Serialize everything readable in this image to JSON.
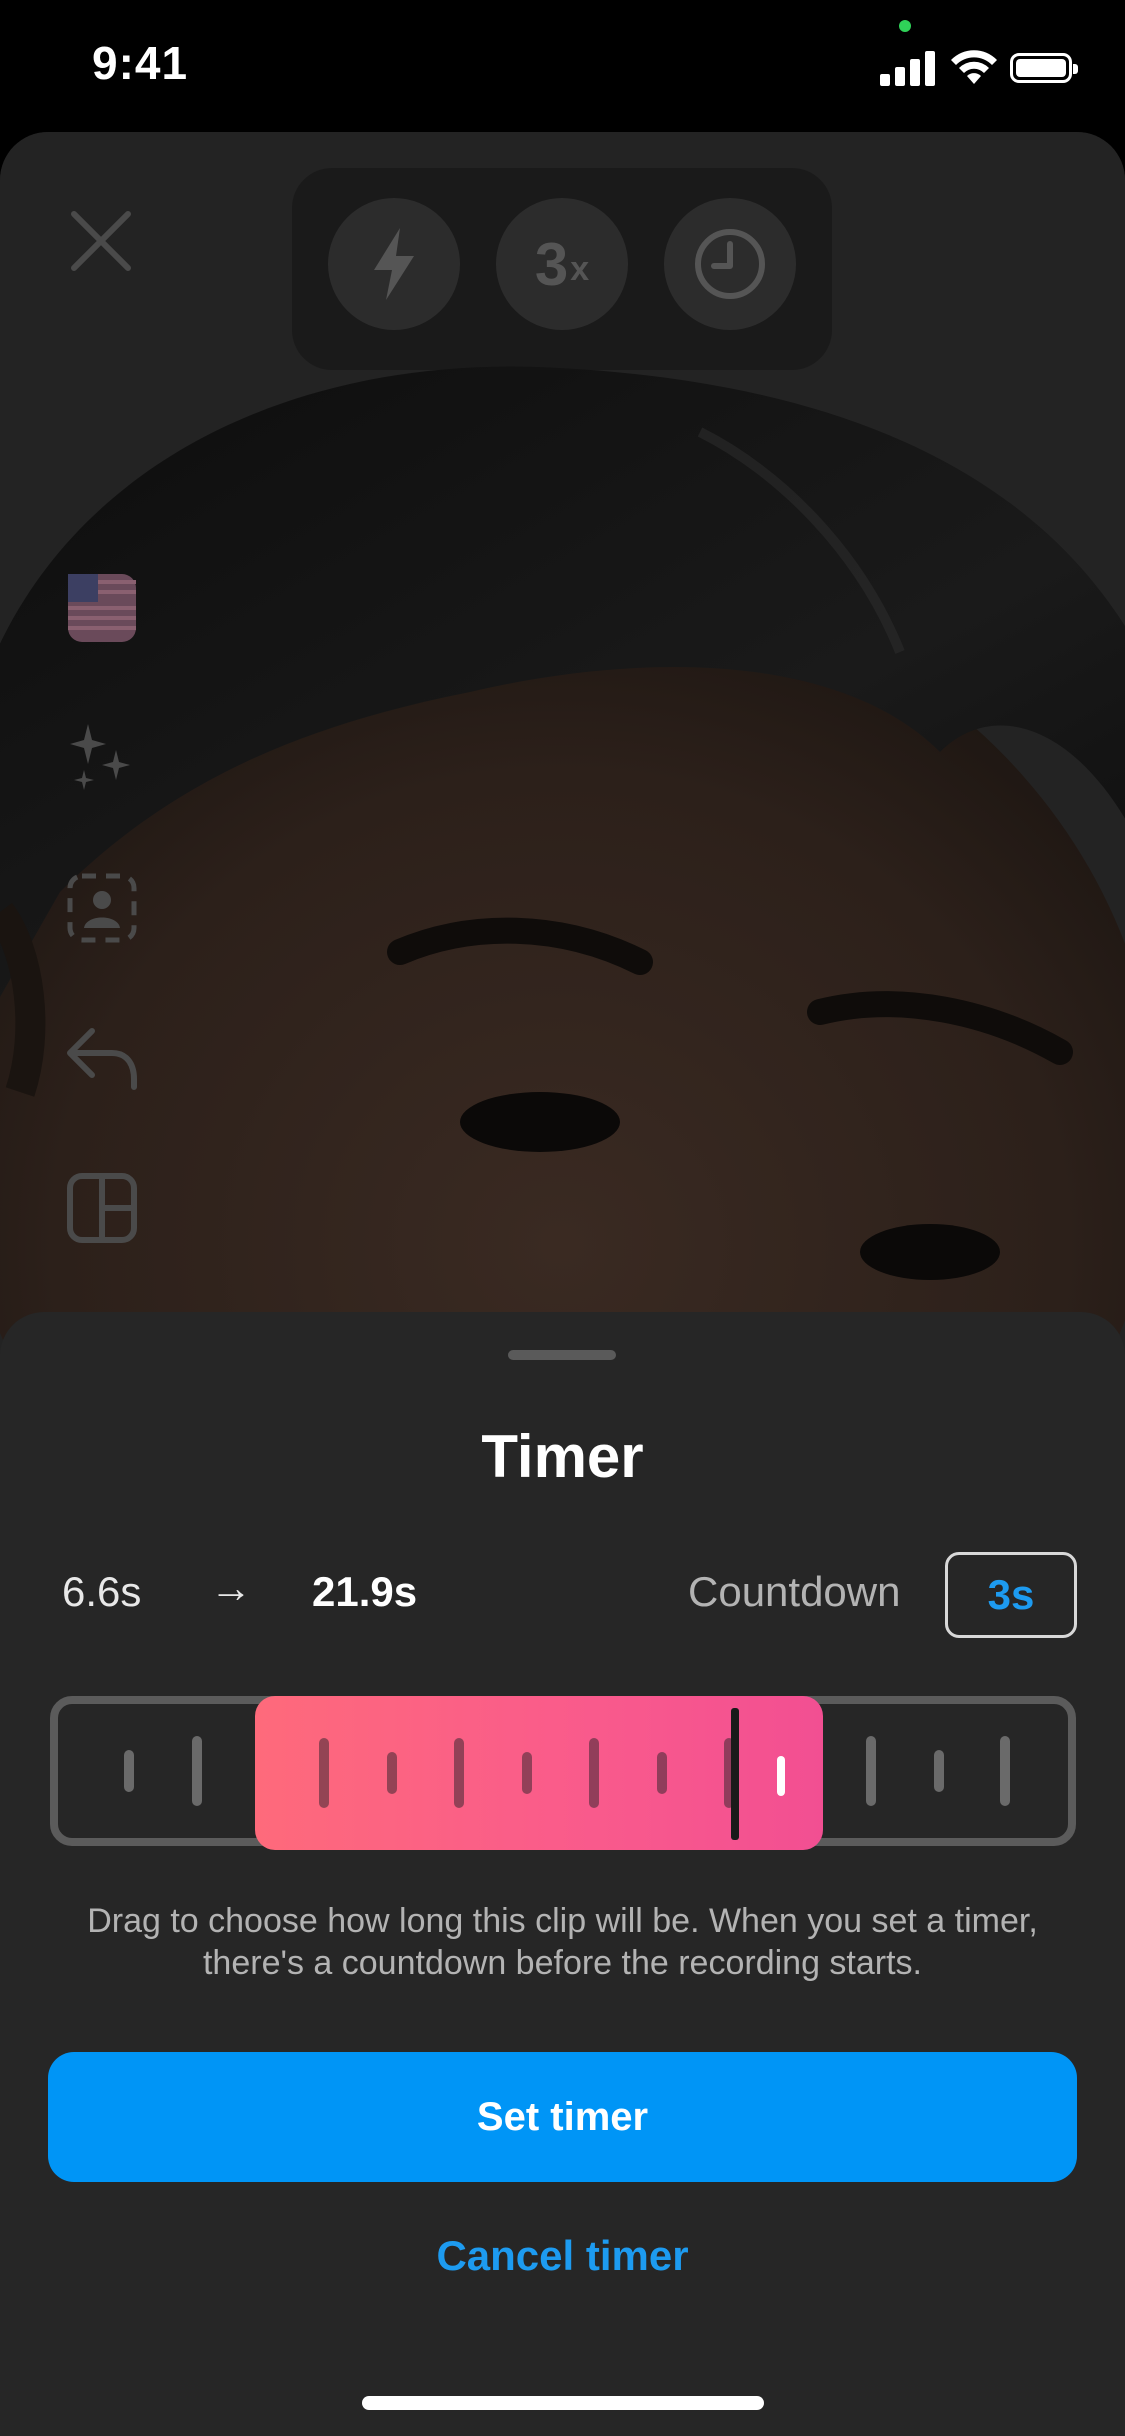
{
  "status_bar": {
    "time": "9:41"
  },
  "top_controls": {
    "flash_icon": "flash-icon",
    "speed_value": "3",
    "speed_suffix": "x",
    "timer_icon": "clock-icon"
  },
  "side_tools": [
    "sticker-flag-icon",
    "effects-sparkle-icon",
    "face-frame-icon",
    "undo-icon",
    "layout-icon"
  ],
  "sheet": {
    "title": "Timer",
    "range_start": "6.6s",
    "range_arrow": "→",
    "range_end": "21.9s",
    "countdown_label": "Countdown",
    "countdown_value": "3s",
    "helper_text": "Drag to choose how long this clip will be. When you set a timer, there's a countdown before the recording starts.",
    "primary_button": "Set timer",
    "secondary_button": "Cancel timer"
  },
  "colors": {
    "accent_blue": "#0095f6",
    "link_blue": "#1d9bf0",
    "selection_gradient_start": "#fe6a7b",
    "selection_gradient_end": "#f24f92",
    "sheet_background": "#262626"
  }
}
